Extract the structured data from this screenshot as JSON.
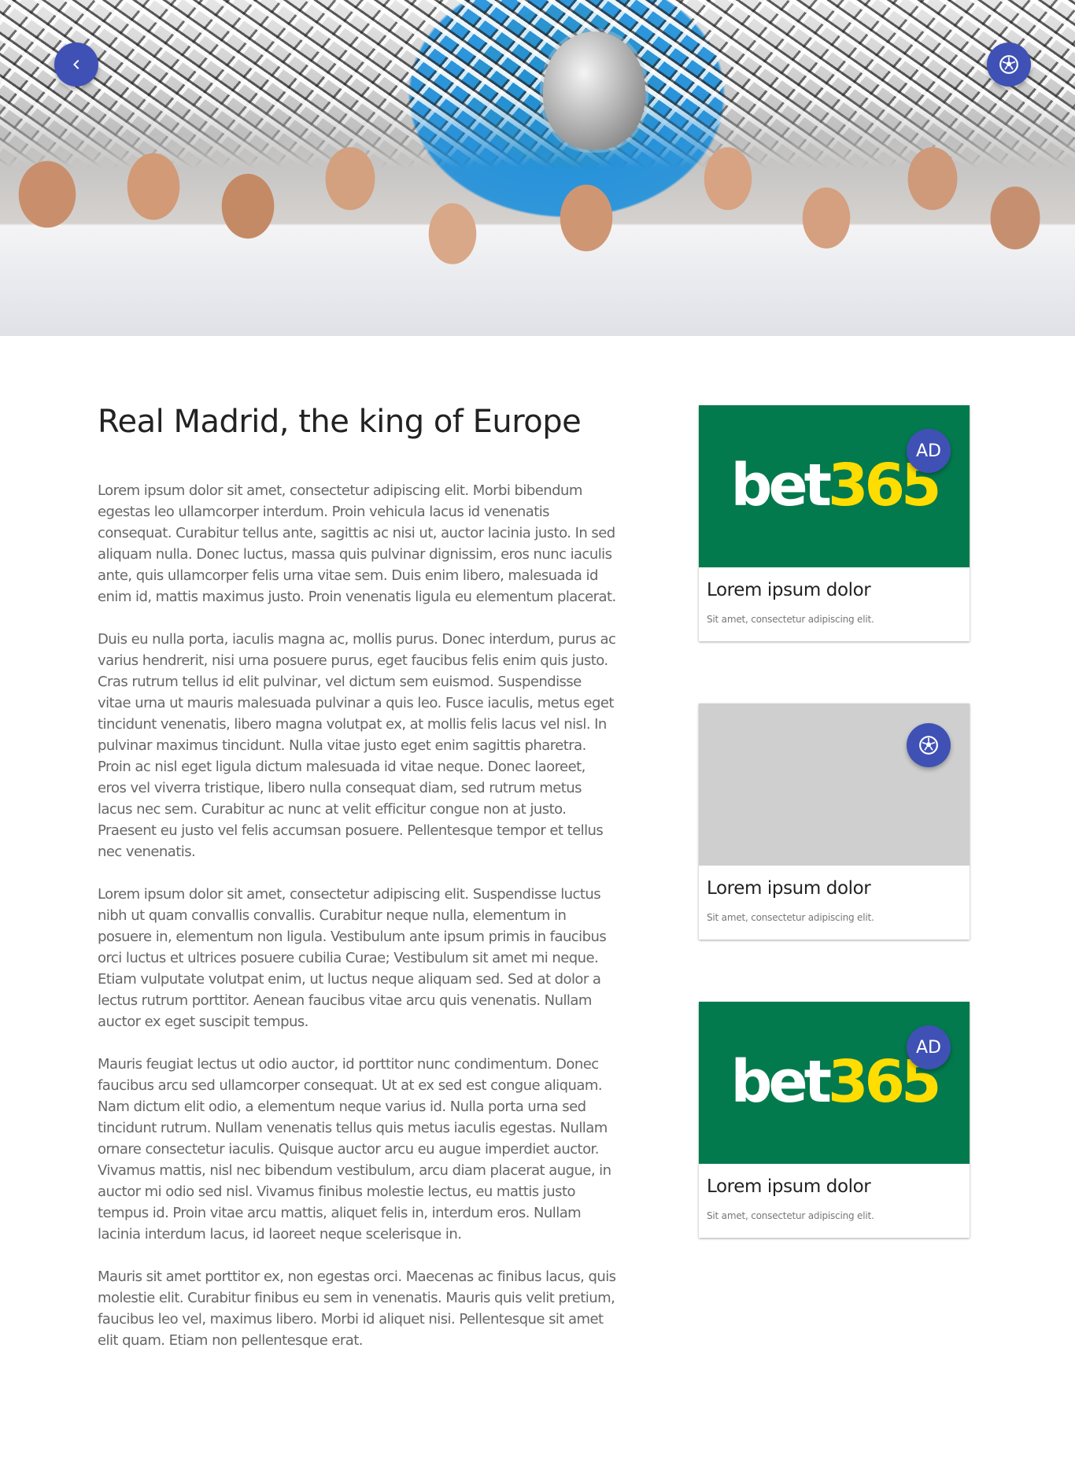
{
  "hero": {
    "back_icon": "chevron-left-icon",
    "action_icon": "soccer-ball-icon"
  },
  "article": {
    "title": "Real Madrid, the king of Europe",
    "paragraphs": [
      "Lorem ipsum dolor sit amet, consectetur adipiscing elit. Morbi bibendum egestas leo ullamcorper interdum. Proin vehicula lacus id venenatis consequat. Curabitur tellus ante, sagittis ac nisi ut, auctor lacinia justo. In sed aliquam nulla. Donec luctus, massa quis pulvinar dignissim, eros nunc iaculis ante, quis ullamcorper felis urna vitae sem. Duis enim libero, malesuada id enim id, mattis maximus justo. Proin venenatis ligula eu elementum placerat.",
      "Duis eu nulla porta, iaculis magna ac, mollis purus. Donec interdum, purus ac varius hendrerit, nisi urna posuere purus, eget faucibus felis enim quis justo. Cras rutrum tellus id elit pulvinar, vel dictum sem euismod. Suspendisse vitae urna ut mauris malesuada pulvinar a quis leo. Fusce iaculis, metus eget tincidunt venenatis, libero magna volutpat ex, at mollis felis lacus vel nisl. In pulvinar maximus tincidunt. Nulla vitae justo eget enim sagittis pharetra. Proin ac nisl eget ligula dictum malesuada id vitae neque. Donec laoreet, eros vel viverra tristique, libero nulla consequat diam, sed rutrum metus lacus nec sem. Curabitur ac nunc at velit efficitur congue non at justo. Praesent eu justo vel felis accumsan posuere. Pellentesque tempor et tellus nec venenatis.",
      "Lorem ipsum dolor sit amet, consectetur adipiscing elit. Suspendisse luctus nibh ut quam convallis convallis. Curabitur neque nulla, elementum in posuere in, elementum non ligula. Vestibulum ante ipsum primis in faucibus orci luctus et ultrices posuere cubilia Curae; Vestibulum sit amet mi neque. Etiam vulputate volutpat enim, ut luctus neque aliquam sed. Sed at dolor a lectus rutrum porttitor. Aenean faucibus vitae arcu quis venenatis. Nullam auctor ex eget suscipit tempus.",
      "Mauris feugiat lectus ut odio auctor, id porttitor nunc condimentum. Donec faucibus arcu sed ullamcorper consequat. Ut at ex sed est congue aliquam. Nam dictum elit odio, a elementum neque varius id. Nulla porta urna sed tincidunt rutrum. Nullam venenatis tellus quis metus iaculis egestas. Nullam ornare consectetur iaculis. Quisque auctor arcu eu augue imperdiet auctor. Vivamus mattis, nisl nec bibendum vestibulum, arcu diam placerat augue, in auctor mi odio sed nisl. Vivamus finibus molestie lectus, eu mattis justo tempus id. Proin vitae arcu mattis, aliquet felis in, interdum eros. Nullam lacinia interdum lacus, id laoreet neque scelerisque in.",
      "Mauris sit amet porttitor ex, non egestas orci. Maecenas ac finibus lacus, quis molestie elit. Curabitur finibus eu sem in venenatis. Mauris quis velit pretium, faucibus leo vel, maximus libero. Morbi id aliquet nisi. Pellentesque sit amet elit quam. Etiam non pellentesque erat."
    ]
  },
  "cards": [
    {
      "type": "ad",
      "logo_part1": "bet",
      "logo_part2": "365",
      "badge": "AD",
      "title": "Lorem ipsum dolor",
      "subtitle": "Sit amet, consectetur adipiscing elit."
    },
    {
      "type": "placeholder",
      "icon": "soccer-ball-icon",
      "title": "Lorem ipsum dolor",
      "subtitle": "Sit amet, consectetur adipiscing elit."
    },
    {
      "type": "ad",
      "logo_part1": "bet",
      "logo_part2": "365",
      "badge": "AD",
      "title": "Lorem ipsum dolor",
      "subtitle": "Sit amet, consectetur adipiscing elit."
    }
  ],
  "colors": {
    "accent": "#3f51b5",
    "ad_background": "#037a4e",
    "logo_yellow": "#ffdd00",
    "placeholder_gray": "#cfcfcf"
  }
}
